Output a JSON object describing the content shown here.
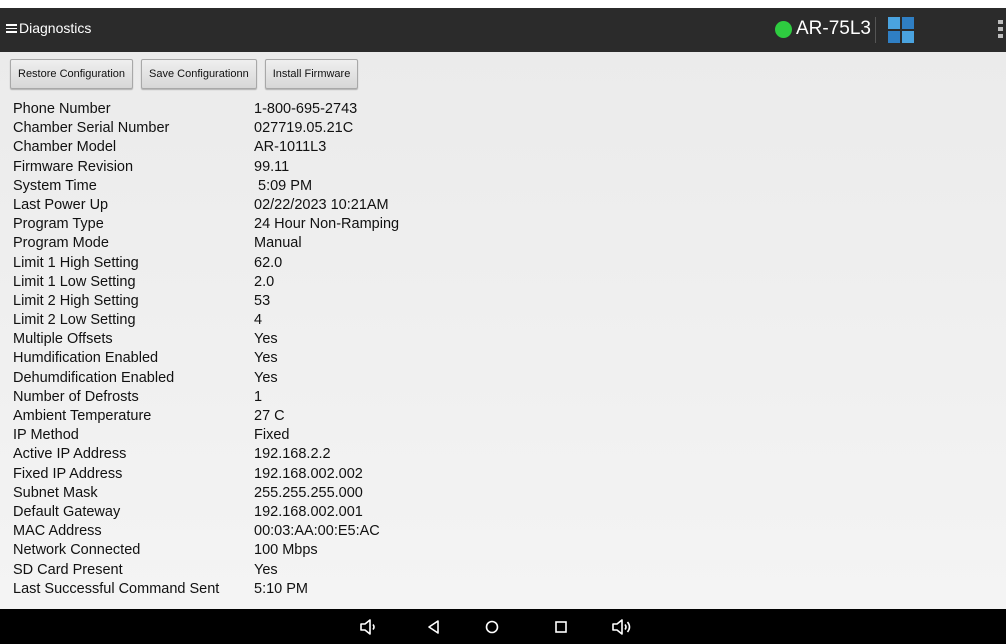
{
  "topbar": {
    "title": "Diagnostics",
    "device_name": "AR-75L3",
    "status_color": "#2ecc40",
    "tile_colors": [
      "#4aa3df",
      "#2f7fc4",
      "#2f7fc4",
      "#4aa3df"
    ],
    "icons": [
      "hamburger-menu-icon",
      "status-dot-icon",
      "tiles-icon",
      "overflow-menu-icon"
    ]
  },
  "toolbar": {
    "restore_label": "Restore Configuration",
    "save_label": "Save Configurationn",
    "install_label": "Install Firmware"
  },
  "info": [
    {
      "label": "Phone Number",
      "value": "1-800-695-2743"
    },
    {
      "label": "Chamber Serial Number",
      "value": "027719.05.21C"
    },
    {
      "label": "Chamber Model",
      "value": "AR-1011L3"
    },
    {
      "label": "Firmware Revision",
      "value": "99.11"
    },
    {
      "label": "System Time",
      "value": " 5:09 PM"
    },
    {
      "label": "Last Power Up",
      "value": "02/22/2023 10:21AM"
    },
    {
      "label": "Program Type",
      "value": "24 Hour Non-Ramping"
    },
    {
      "label": "Program Mode",
      "value": "Manual"
    },
    {
      "label": "Limit 1 High Setting",
      "value": "62.0"
    },
    {
      "label": "Limit 1 Low Setting",
      "value": "2.0"
    },
    {
      "label": "Limit 2 High Setting",
      "value": "53"
    },
    {
      "label": "Limit 2 Low Setting",
      "value": "4"
    },
    {
      "label": "Multiple Offsets",
      "value": "Yes"
    },
    {
      "label": "Humdification Enabled",
      "value": "Yes"
    },
    {
      "label": "Dehumdification Enabled",
      "value": "Yes"
    },
    {
      "label": "Number of Defrosts",
      "value": "1"
    },
    {
      "label": "Ambient Temperature",
      "value": "27 C"
    },
    {
      "label": "IP Method",
      "value": "Fixed"
    },
    {
      "label": "Active IP Address",
      "value": "192.168.2.2"
    },
    {
      "label": "Fixed IP Address",
      "value": "192.168.002.002"
    },
    {
      "label": "Subnet Mask",
      "value": "255.255.255.000"
    },
    {
      "label": "Default Gateway",
      "value": "192.168.002.001"
    },
    {
      "label": "MAC Address",
      "value": "00:03:AA:00:E5:AC"
    },
    {
      "label": "Network Connected",
      "value": "100 Mbps"
    },
    {
      "label": "SD Card Present",
      "value": "Yes"
    },
    {
      "label": "Last Successful Command Sent",
      "value": "5:10 PM"
    }
  ],
  "navbar": {
    "icons": [
      "volume-down-icon",
      "back-icon",
      "home-icon",
      "recents-icon",
      "volume-up-icon"
    ]
  }
}
